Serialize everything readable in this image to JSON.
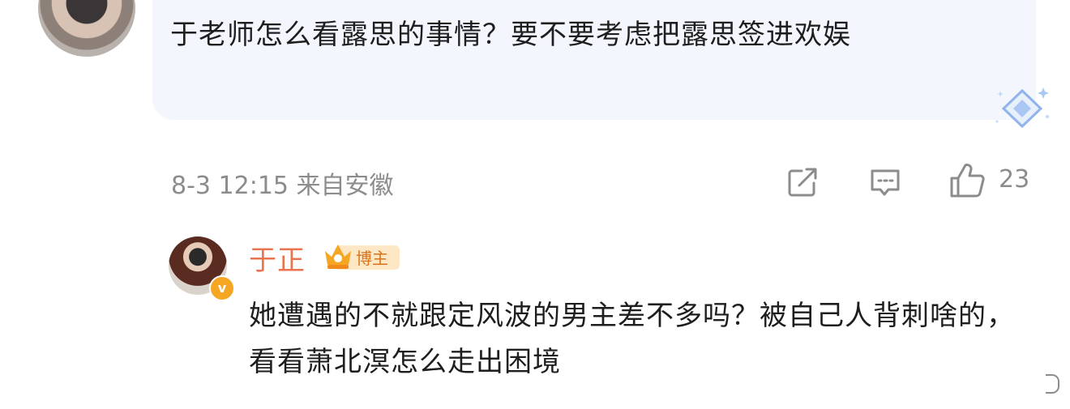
{
  "comment": {
    "text": "于老师怎么看露思的事情？要不要考虑把露思签进欢娱",
    "timestamp": "8-3 12:15",
    "location": "来自安徽",
    "like_count": "23",
    "icons": [
      "share-icon",
      "comment-icon",
      "like-icon"
    ]
  },
  "reply": {
    "author": "于正",
    "badge_label": "博主",
    "verified_mark": "v",
    "text": "她遭遇的不就跟定风波的男主差不多吗？被自己人背刺啥的，看看萧北溟怎么走出困境 ",
    "accent_color": "#eb7350"
  }
}
